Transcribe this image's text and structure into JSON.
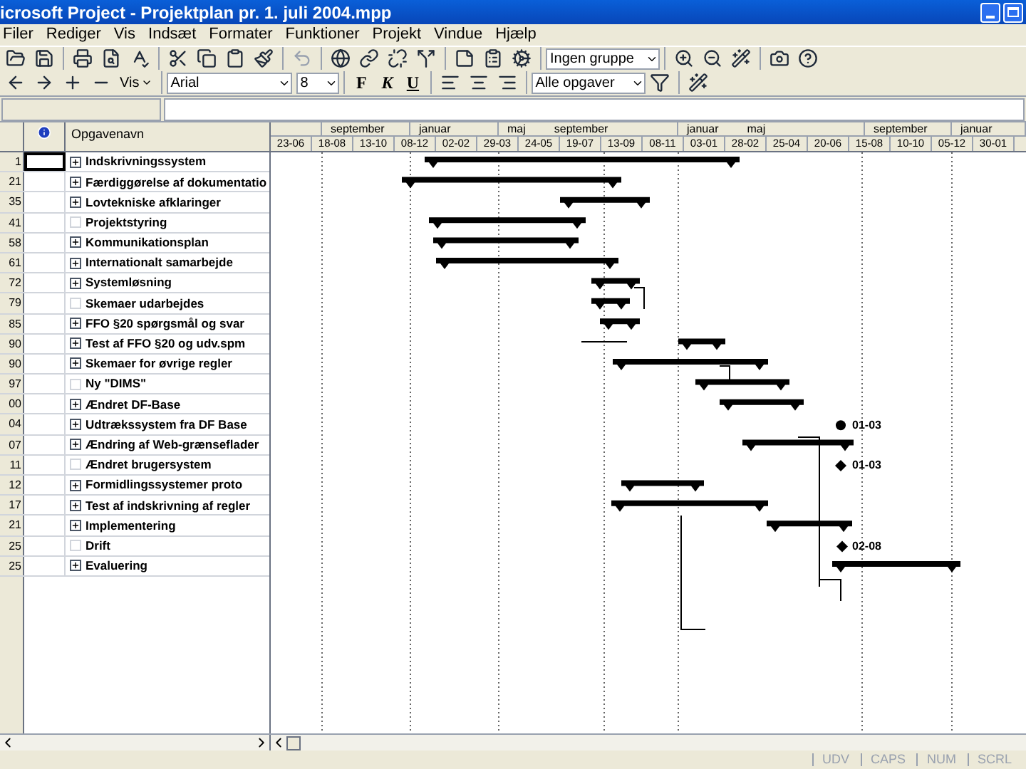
{
  "window": {
    "title": "icrosoft Project - Projektplan pr. 1. juli 2004.mpp"
  },
  "menu": [
    "Filer",
    "Rediger",
    "Vis",
    "Indsæt",
    "Formater",
    "Funktioner",
    "Projekt",
    "Vindue",
    "Hjælp"
  ],
  "toolbar": {
    "group_dropdown": "Ingen gruppe"
  },
  "format_bar": {
    "show_menu": "Vis",
    "font": "Arial",
    "size": "8",
    "bold": "F",
    "italic": "K",
    "underline": "U",
    "filter_dropdown": "Alle opgaver"
  },
  "table": {
    "column_header": "Opgavenavn",
    "rows": [
      {
        "id": "1",
        "name": "Indskrivningssystem",
        "collapsed": true,
        "selected": true
      },
      {
        "id": "21",
        "name": "Færdiggørelse af dokumentatio",
        "collapsed": true,
        "selected": false
      },
      {
        "id": "35",
        "name": "Lovtekniske afklaringer",
        "collapsed": true,
        "selected": false
      },
      {
        "id": "41",
        "name": "Projektstyring",
        "collapsed": false,
        "selected": false
      },
      {
        "id": "58",
        "name": "Kommunikationsplan",
        "collapsed": true,
        "selected": false
      },
      {
        "id": "61",
        "name": "Internationalt samarbejde",
        "collapsed": true,
        "selected": false
      },
      {
        "id": "72",
        "name": "Systemløsning",
        "collapsed": true,
        "selected": false
      },
      {
        "id": "79",
        "name": "Skemaer udarbejdes",
        "collapsed": false,
        "selected": false
      },
      {
        "id": "85",
        "name": "FFO §20 spørgsmål og svar",
        "collapsed": true,
        "selected": false
      },
      {
        "id": "90",
        "name": "Test af FFO §20 og udv.spm",
        "collapsed": true,
        "selected": false
      },
      {
        "id": "90",
        "name": "Skemaer for øvrige regler",
        "collapsed": true,
        "selected": false
      },
      {
        "id": "97",
        "name": "Ny \"DIMS\"",
        "collapsed": false,
        "selected": false
      },
      {
        "id": "00",
        "name": "Ændret DF-Base",
        "collapsed": true,
        "selected": false
      },
      {
        "id": "04",
        "name": "Udtrækssystem fra DF Base",
        "collapsed": true,
        "selected": false,
        "gantt_label": "01-03"
      },
      {
        "id": "07",
        "name": "Ændring af Web-grænseflader",
        "collapsed": true,
        "selected": false
      },
      {
        "id": "11",
        "name": "Ændret brugersystem",
        "collapsed": false,
        "selected": false,
        "gantt_label": "01-03"
      },
      {
        "id": "12",
        "name": "Formidlingssystemer proto",
        "collapsed": true,
        "selected": false
      },
      {
        "id": "17",
        "name": "Test af indskrivning af regler",
        "collapsed": true,
        "selected": false
      },
      {
        "id": "21",
        "name": "Implementering",
        "collapsed": true,
        "selected": false
      },
      {
        "id": "25",
        "name": "Drift",
        "collapsed": false,
        "selected": false,
        "gantt_label": "02-08"
      },
      {
        "id": "25",
        "name": "Evaluering",
        "collapsed": true,
        "selected": false
      }
    ]
  },
  "timescale": {
    "upper": [
      {
        "labels": [
          "september"
        ]
      },
      {
        "labels": [
          "januar"
        ]
      },
      {
        "labels": [
          "maj",
          "september"
        ]
      },
      {
        "labels": [
          "januar",
          "maj"
        ]
      },
      {
        "labels": [
          "september"
        ]
      },
      {
        "labels": [
          "januar"
        ]
      }
    ],
    "lower": [
      "23-06",
      "18-08",
      "13-10",
      "08-12",
      "02-02",
      "29-03",
      "24-05",
      "19-07",
      "13-09",
      "08-11",
      "03-01",
      "28-02",
      "25-04",
      "20-06",
      "15-08",
      "10-10",
      "05-12",
      "30-01"
    ]
  },
  "status_bar": {
    "indicators": [
      "UDV",
      "CAPS",
      "NUM",
      "SCRL"
    ]
  }
}
